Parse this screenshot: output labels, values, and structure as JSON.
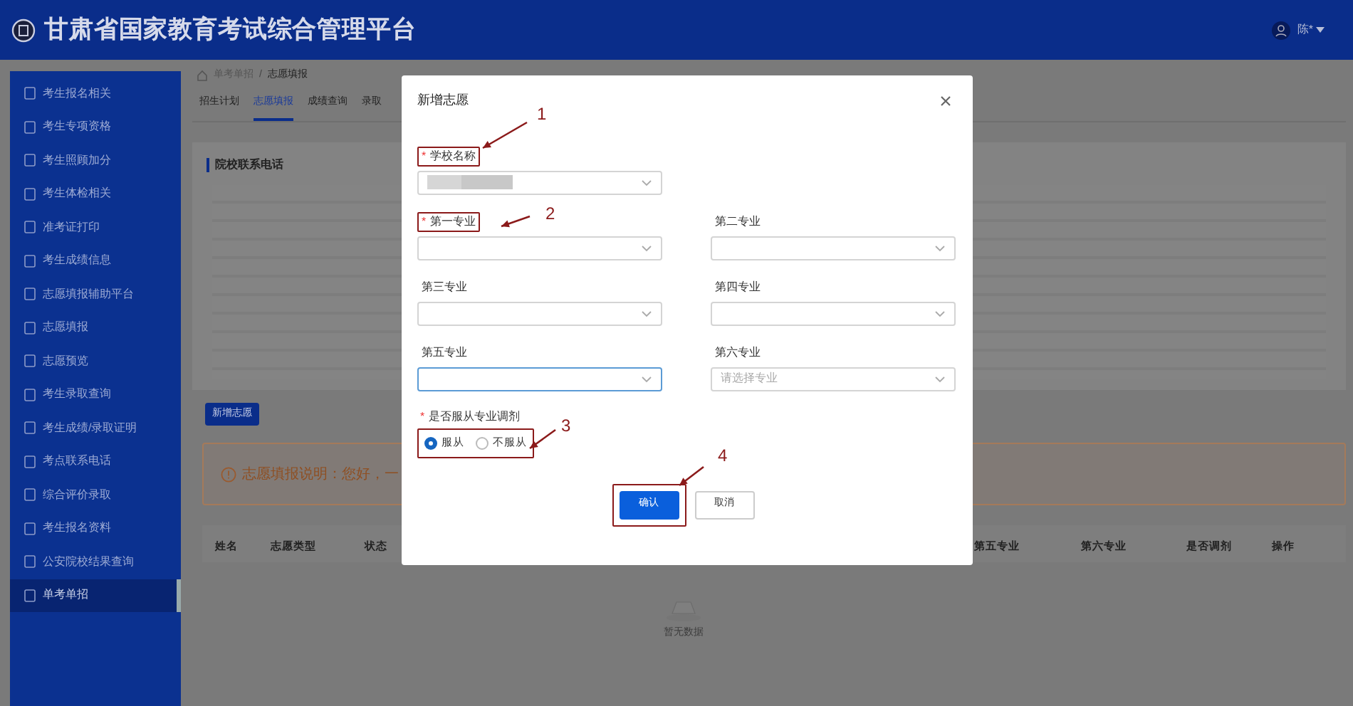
{
  "header": {
    "title": "甘肃省国家教育考试综合管理平台",
    "user_name": "陈*"
  },
  "sidebar": {
    "items": [
      {
        "label": "考生报名相关",
        "selected": false
      },
      {
        "label": "考生专项资格",
        "selected": false
      },
      {
        "label": "考生照顾加分",
        "selected": false
      },
      {
        "label": "考生体检相关",
        "selected": false
      },
      {
        "label": "准考证打印",
        "selected": false
      },
      {
        "label": "考生成绩信息",
        "selected": false
      },
      {
        "label": "志愿填报辅助平台",
        "selected": false
      },
      {
        "label": "志愿填报",
        "selected": false
      },
      {
        "label": "志愿预览",
        "selected": false
      },
      {
        "label": "考生录取查询",
        "selected": false
      },
      {
        "label": "考生成绩/录取证明",
        "selected": false
      },
      {
        "label": "考点联系电话",
        "selected": false
      },
      {
        "label": "综合评价录取",
        "selected": false
      },
      {
        "label": "考生报名资料",
        "selected": false
      },
      {
        "label": "公安院校结果查询",
        "selected": false
      },
      {
        "label": "单考单招",
        "selected": true
      }
    ]
  },
  "breadcrumb": [
    {
      "kind": "link",
      "label": "单考单招"
    },
    {
      "kind": "separator",
      "label": "/"
    },
    {
      "kind": "current",
      "label": "志愿填报"
    }
  ],
  "tabs": [
    {
      "label": "招生计划",
      "selected": false
    },
    {
      "label": "志愿填报",
      "selected": true
    },
    {
      "label": "成绩查询",
      "selected": false
    },
    {
      "label": "录取",
      "selected": false
    }
  ],
  "card": {
    "title": "院校联系电话"
  },
  "add_button": "新增志愿",
  "alert": {
    "text": "志愿填报说明：您好，一"
  },
  "table": {
    "columns": [
      "姓名",
      "志愿类型",
      "状态",
      "第五专业",
      "第六专业",
      "是否调剂",
      "操作"
    ],
    "empty_text": "暂无数据"
  },
  "dialog": {
    "title": "新增志愿",
    "fields": [
      {
        "label": "学校名称",
        "required_mark": "*",
        "redacted": true,
        "focused": false
      },
      {
        "label": "第一专业",
        "required_mark": "*",
        "focused": false
      },
      {
        "label": "第二专业",
        "focused": false
      },
      {
        "label": "第三专业",
        "focused": false
      },
      {
        "label": "第四专业",
        "focused": false
      },
      {
        "label": "第五专业",
        "focused": true
      },
      {
        "label": "第六专业",
        "focused": false,
        "placeholder": "请选择专业"
      }
    ],
    "adjust": {
      "label": "是否服从专业调剂",
      "required_mark": "*",
      "options": [
        {
          "label": "服从",
          "selected": true
        },
        {
          "label": "不服从",
          "selected": false
        }
      ]
    },
    "buttons": [
      {
        "label": "确认",
        "kind": "primary"
      },
      {
        "label": "取消",
        "kind": "default"
      }
    ]
  },
  "annotations": [
    {
      "label": "1"
    },
    {
      "label": "2"
    },
    {
      "label": "3"
    },
    {
      "label": "4"
    }
  ]
}
